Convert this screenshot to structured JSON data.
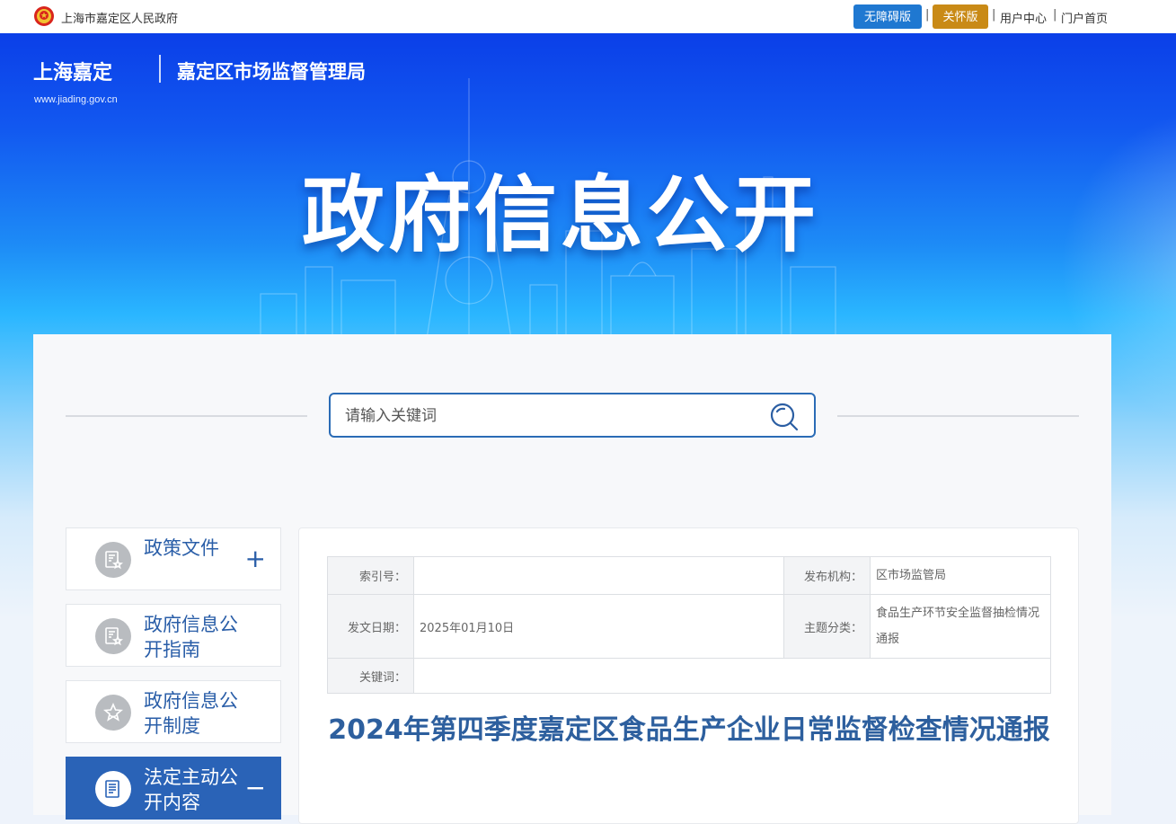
{
  "topbar": {
    "gov_name": "上海市嘉定区人民政府",
    "accessible_label": "无障碍版",
    "care_label": "关怀版",
    "separator": "|",
    "user_center": "用户中心",
    "portal_home": "门户首页"
  },
  "header": {
    "logo_text": "上海嘉定",
    "logo_url": "www.jiading.gov.cn",
    "dept_name": "嘉定区市场监督管理局",
    "hero_title": "政府信息公开"
  },
  "search": {
    "placeholder": "请输入关键词"
  },
  "sidebar": {
    "items": [
      {
        "label": "政策文件",
        "toggle": "+"
      },
      {
        "label": "政府信息公开指南"
      },
      {
        "label": "政府信息公开制度"
      },
      {
        "label": "法定主动公开内容",
        "toggle": "−"
      }
    ]
  },
  "meta": {
    "index_no_label": "索引号：",
    "index_no_value": "",
    "publisher_label": "发布机构：",
    "publisher_value": "区市场监管局",
    "date_label": "发文日期：",
    "date_value": "2025年01月10日",
    "topic_label": "主题分类：",
    "topic_value": "食品生产环节安全监督抽检情况通报",
    "keywords_label": "关键词：",
    "keywords_value": ""
  },
  "article": {
    "title": "2024年第四季度嘉定区食品生产企业日常监督检查情况通报"
  },
  "colors": {
    "accent": "#2a63b7",
    "access_btn": "#1f78d1",
    "care_btn": "#c98a16",
    "title_blue": "#2d5f9e"
  }
}
